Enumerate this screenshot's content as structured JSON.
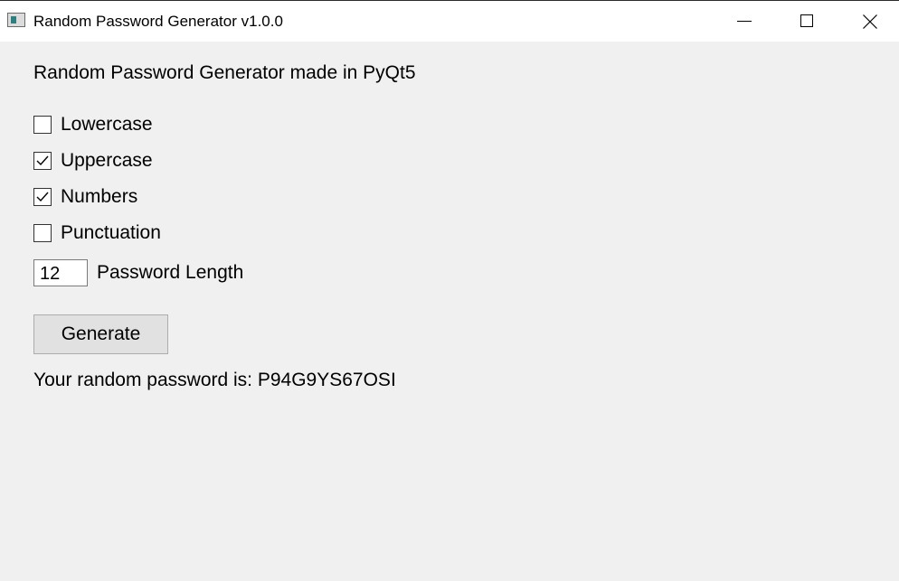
{
  "window": {
    "title": "Random Password Generator v1.0.0",
    "controls": {
      "minimize_icon": "minimize-icon",
      "maximize_icon": "maximize-icon",
      "close_icon": "close-icon"
    }
  },
  "main": {
    "heading": "Random Password Generator made in PyQt5",
    "options": [
      {
        "label": "Lowercase",
        "checked": false
      },
      {
        "label": "Uppercase",
        "checked": true
      },
      {
        "label": "Numbers",
        "checked": true
      },
      {
        "label": "Punctuation",
        "checked": false
      }
    ],
    "length": {
      "value": "12",
      "label": "Password Length"
    },
    "generate_label": "Generate",
    "result_text": "Your random password is: P94G9YS67OSI"
  },
  "colors": {
    "window_bg": "#f0f0f0",
    "titlebar_bg": "#ffffff",
    "button_bg": "#e1e1e1"
  }
}
